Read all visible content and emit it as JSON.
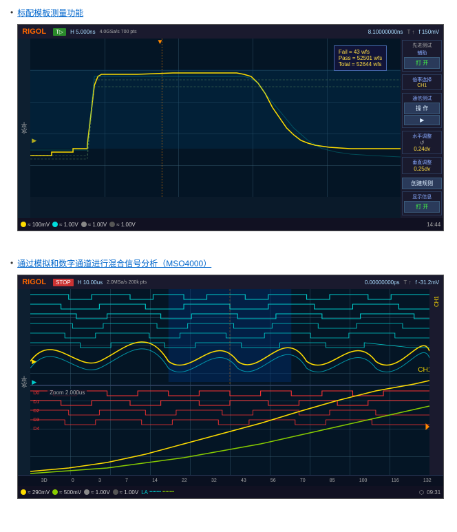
{
  "section1": {
    "bullet": "•",
    "link_text": "标配模板测量功能",
    "scope": {
      "logo": "RIGOL",
      "status": "T▷",
      "time_div": "H  5.000ns",
      "sample_rate": "4.0GSa/s 700 pts",
      "trigger_time": "8.10000000ns",
      "trigger_icon": "T",
      "voltage": "f  150mV",
      "ylabel": "水平",
      "waveform_info": {
        "fail": "Fail = 43 wfs",
        "pass": "Pass = 52501 wfs",
        "total": "Total = 52644 wfs"
      },
      "right_panel": {
        "advanced_test_label": "先进测试",
        "assist_label": "辅助",
        "open_label": "打  开",
        "channel_select_label": "倍率选择",
        "channel_label": "CH1",
        "comm_test_label": "通信测试",
        "operation_label": "操  作",
        "play_label": "▶",
        "h_adjust_label": "水平调整",
        "h_value": "0.24dv",
        "v_adjust_label": "垂直调整",
        "v_value": "0.25dv",
        "create_rule_label": "创建规则",
        "show_info_label": "显示信息",
        "show_open_label": "打  开"
      },
      "bottom": {
        "ch1": "≈ 100mV",
        "ch2": "≈  1.00V",
        "ch3": "≈  1.00V",
        "ch4": "≈  1.00V",
        "time": "14:44"
      }
    }
  },
  "section2": {
    "bullet": "•",
    "link_text": "通过模拟和数字通道进行混合信号分析（MSO4000）",
    "scope": {
      "logo": "RIGOL",
      "status": "STOP",
      "time_div": "H  10.00us",
      "sample_rate": "2.0MSa/s 200k pts",
      "trigger_time": "0.00000000ps",
      "voltage": "f  -31.2mV",
      "ylabel": "水平",
      "ch1_label": "CH1",
      "zoom_label": "Zoom 2.000us",
      "xaxis_labels": [
        "0",
        "3",
        "7",
        "14",
        "22",
        "32",
        "43",
        "56",
        "70",
        "85",
        "100",
        "116",
        "132"
      ],
      "bottom": {
        "ch1": "≈ 290mV",
        "ch2": "≈ 500mV",
        "ch3": "≈  1.00V",
        "ch4": "≈  1.00V",
        "la": "LA",
        "time": "09:31"
      }
    }
  }
}
